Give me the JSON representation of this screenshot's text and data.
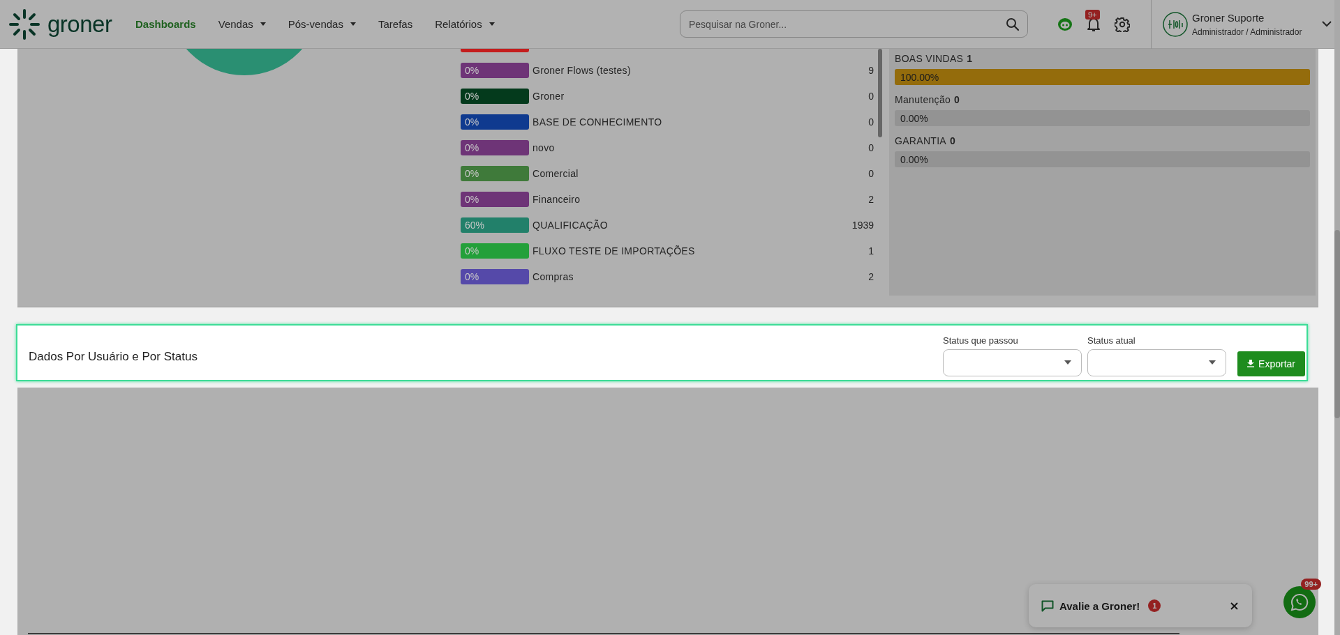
{
  "header": {
    "logo": "groner",
    "nav": [
      {
        "label": "Dashboards",
        "selected": true,
        "has_menu": false
      },
      {
        "label": "Vendas",
        "selected": false,
        "has_menu": true
      },
      {
        "label": "Pós-vendas",
        "selected": false,
        "has_menu": true
      },
      {
        "label": "Tarefas",
        "selected": false,
        "has_menu": false
      },
      {
        "label": "Relatórios",
        "selected": false,
        "has_menu": true
      }
    ],
    "search": {
      "placeholder": "Pesquisar na Groner..."
    },
    "notifications": {
      "badge": "9+"
    },
    "user": {
      "name": "Groner Suporte",
      "role": "Administrador / Administrador"
    }
  },
  "status_list": {
    "items": [
      {
        "color": "#c41e1e"
      },
      {
        "percent": "0%",
        "label": "Groner Flows (testes)",
        "count": "9",
        "color": "#6e3477"
      },
      {
        "percent": "0%",
        "label": "Groner",
        "count": "0",
        "color": "#043a1c"
      },
      {
        "percent": "0%",
        "label": "BASE DE CONHECIMENTO",
        "count": "0",
        "color": "#0f3a8f"
      },
      {
        "percent": "0%",
        "label": "novo",
        "count": "0",
        "color": "#6e3477"
      },
      {
        "percent": "0%",
        "label": "Comercial",
        "count": "0",
        "color": "#3f7a3a"
      },
      {
        "percent": "0%",
        "label": "Financeiro",
        "count": "2",
        "color": "#6e3477"
      },
      {
        "percent": "60%",
        "label": "QUALIFICAÇÃO",
        "count": "1939",
        "color": "#22806a"
      },
      {
        "percent": "0%",
        "label": "FLUXO TESTE DE IMPORTAÇÕES",
        "count": "1",
        "color": "#23a03a"
      },
      {
        "percent": "0%",
        "label": "Compras",
        "count": "2",
        "color": "#5549a9"
      }
    ]
  },
  "funnels": [
    {
      "name": "BOAS VINDAS",
      "count": "1",
      "percent": "100.00%",
      "level": 1
    },
    {
      "name": "Manutenção",
      "count": "0",
      "percent": "0.00%",
      "level": 0
    },
    {
      "name": "GARANTIA",
      "count": "0",
      "percent": "0.00%",
      "level": 0
    }
  ],
  "users_section": {
    "title": "Dados Por Usuário e Por Status",
    "filters": [
      {
        "label": "Status que passou"
      },
      {
        "label": "Status atual"
      }
    ],
    "export_button": "Exportar"
  },
  "feedback_toast": {
    "text": "Avalie a Groner!",
    "badge": "1"
  },
  "whatsapp": {
    "badge": "99+"
  }
}
